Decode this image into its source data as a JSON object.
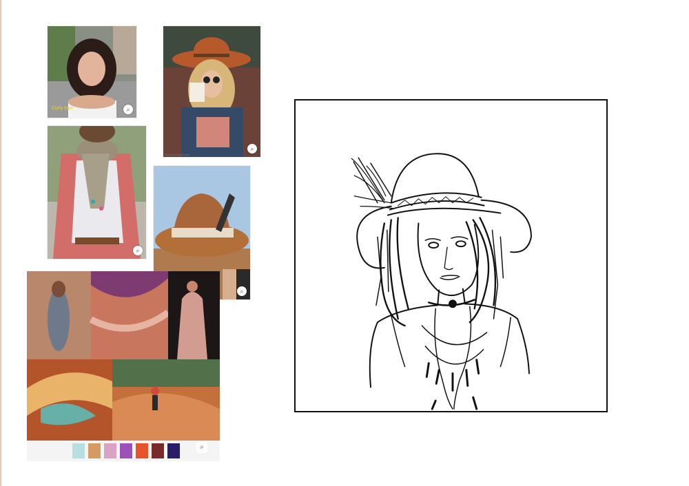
{
  "references": {
    "curly_hair": {
      "caption": "Curly Hair",
      "lens_icon": "⌕"
    },
    "hat_coffee": {
      "credit": "ditaStreetStyleSpace",
      "lens_icon": "⌕"
    },
    "scarf": {
      "lens_icon": "⌕"
    },
    "feather_hat": {
      "lens_icon": "⌕"
    }
  },
  "moodboard": {
    "palette": [
      "#b7dfe0",
      "#d69a63",
      "#d9a3c6",
      "#9b51b8",
      "#e5542a",
      "#7a2a2a",
      "#2c1d6b"
    ],
    "lens_icon": "⌕"
  }
}
